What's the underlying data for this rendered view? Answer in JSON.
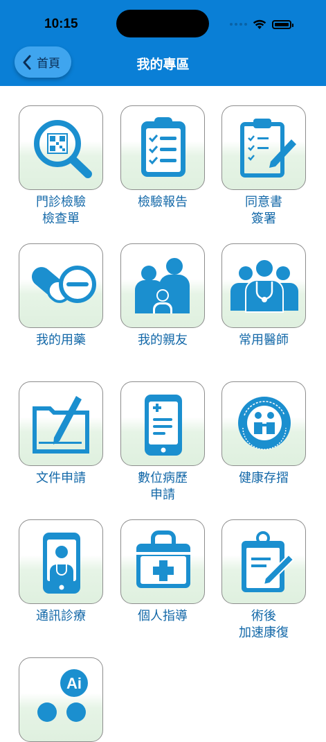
{
  "status_bar": {
    "time": "10:15"
  },
  "header": {
    "title": "我的專區",
    "back_label": "首頁"
  },
  "items": [
    {
      "line1": "門診檢驗",
      "line2": "檢查單",
      "icon": "qr-magnifier-icon"
    },
    {
      "line1": "檢驗報告",
      "line2": "",
      "icon": "checklist-clipboard-icon"
    },
    {
      "line1": "同意書",
      "line2": "簽署",
      "icon": "clipboard-pen-icon"
    },
    {
      "line1": "我的用藥",
      "line2": "",
      "icon": "pills-icon"
    },
    {
      "line1": "我的親友",
      "line2": "",
      "icon": "family-icon"
    },
    {
      "line1": "常用醫師",
      "line2": "",
      "icon": "doctors-icon"
    },
    {
      "line1": "文件申請",
      "line2": "",
      "icon": "document-pen-icon"
    },
    {
      "line1": "數位病歷",
      "line2": "申請",
      "icon": "phone-medical-record-icon"
    },
    {
      "line1": "健康存摺",
      "line2": "",
      "icon": "nhi-logo-icon"
    },
    {
      "line1": "通訊診療",
      "line2": "",
      "icon": "telemedicine-phone-icon"
    },
    {
      "line1": "個人指導",
      "line2": "",
      "icon": "medical-kit-icon"
    },
    {
      "line1": "術後",
      "line2": "加速康復",
      "icon": "recovery-clipboard-icon"
    },
    {
      "line1": "",
      "line2": "",
      "icon": "ai-chat-icon"
    }
  ],
  "colors": {
    "header_blue": "#0a7fd6",
    "icon_blue": "#1b8fcf",
    "label_blue": "#1368a8"
  }
}
